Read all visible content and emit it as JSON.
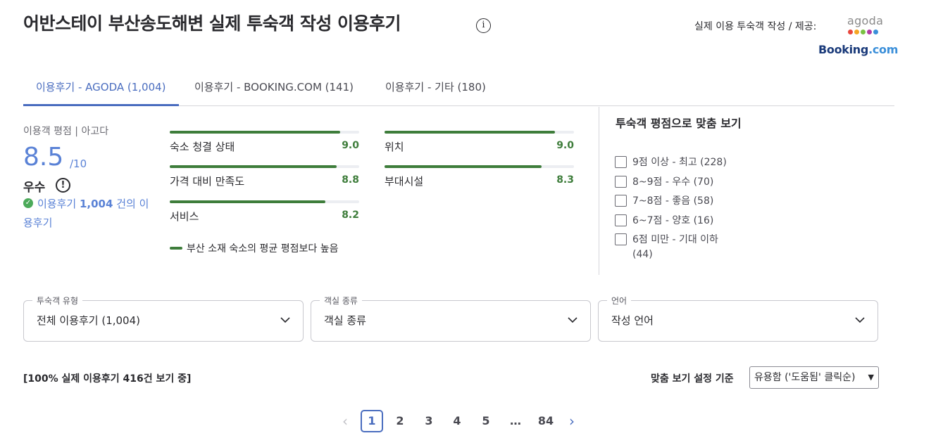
{
  "header": {
    "title": "어반스테이 부산송도해변 실제 투숙객 작성 이용후기",
    "info_icon": "i",
    "provider_label": "실제 이용 투숙객 작성 / 제공:",
    "agoda_logo": "agoda",
    "booking_logo_main": "Booking",
    "booking_logo_com": ".com"
  },
  "tabs": [
    {
      "label": "이용후기 - AGODA (1,004)",
      "active": true
    },
    {
      "label": "이용후기 - BOOKING.COM (141)",
      "active": false
    },
    {
      "label": "이용후기 - 기타 (180)",
      "active": false
    }
  ],
  "rating": {
    "label": "이용객 평점 | 아고다",
    "score": "8.5",
    "score_max": "/10",
    "grade": "우수",
    "grade_icon": "!",
    "review_count_prefix": "이용후기",
    "review_count_number": "1,004",
    "review_count_suffix": "건의 이용후기"
  },
  "categories": [
    {
      "label": "숙소 청결 상태",
      "value": "9.0",
      "fraction": 0.9
    },
    {
      "label": "위치",
      "value": "9.0",
      "fraction": 0.9
    },
    {
      "label": "가격 대비 만족도",
      "value": "8.8",
      "fraction": 0.88
    },
    {
      "label": "부대시설",
      "value": "8.3",
      "fraction": 0.83
    },
    {
      "label": "서비스",
      "value": "8.2",
      "fraction": 0.82
    }
  ],
  "legend": "부산 소재 숙소의 평균 평점보다 높음",
  "filter": {
    "title": "투숙객 평점으로 맞춤 보기",
    "items": [
      "9점 이상 - 최고 (228)",
      "8~9점 - 우수 (70)",
      "7~8점 - 좋음 (58)",
      "6~7점 - 양호 (16)",
      "6점 미만 - 기대 이하 (44)"
    ]
  },
  "selects": [
    {
      "legend": "투숙객 유형",
      "value": "전체 이용후기 (1,004)"
    },
    {
      "legend": "객실 종류",
      "value": "객실 종류"
    },
    {
      "legend": "언어",
      "value": "작성 언어"
    }
  ],
  "status": {
    "showing": "[100% 실제 이용후기 416건 보기 중]",
    "sort_label": "맞춤 보기 설정 기준",
    "sort_value": "유용함 ('도움됨' 클릭순)"
  },
  "pagination": {
    "pages": [
      "1",
      "2",
      "3",
      "4",
      "5",
      "…",
      "84"
    ],
    "current": "1"
  },
  "colors": {
    "accent": "#4a6dbf",
    "score_blue": "#5a82d6",
    "bar_green": "#3e7d3b"
  }
}
